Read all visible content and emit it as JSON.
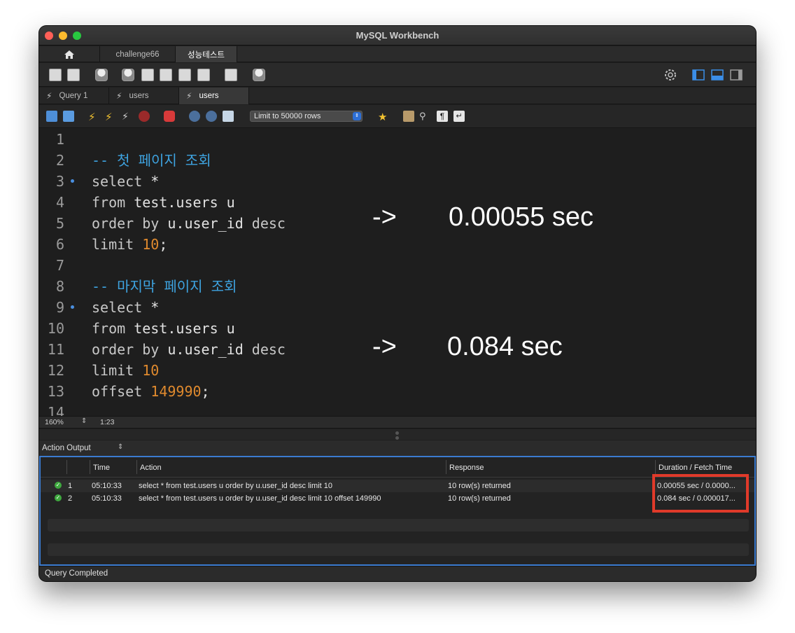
{
  "window": {
    "title": "MySQL Workbench"
  },
  "tabs": [
    {
      "label": "challenge66"
    },
    {
      "label": "성능테스트"
    }
  ],
  "query_tabs": [
    {
      "label": "Query 1"
    },
    {
      "label": "users"
    },
    {
      "label": "users"
    }
  ],
  "editor_toolbar": {
    "limit_label": "Limit to 50000 rows"
  },
  "editor": {
    "lines": [
      {
        "n": "1"
      },
      {
        "n": "2",
        "comment": "-- 첫 페이지 조회"
      },
      {
        "n": "3",
        "kw": "select",
        "rest": " *"
      },
      {
        "n": "4",
        "kw": "from",
        "rest": " test.users u"
      },
      {
        "n": "5",
        "kw": "order by",
        "rest": " u.user_id ",
        "kw2": "desc"
      },
      {
        "n": "6",
        "kw": "limit",
        "rest": " ",
        "num": "10",
        "tail": ";"
      },
      {
        "n": "7"
      },
      {
        "n": "8",
        "comment": "-- 마지막 페이지 조회"
      },
      {
        "n": "9",
        "kw": "select",
        "rest": " *"
      },
      {
        "n": "10",
        "kw": "from",
        "rest": " test.users u"
      },
      {
        "n": "11",
        "kw": "order by",
        "rest": " u.user_id ",
        "kw2": "desc"
      },
      {
        "n": "12",
        "kw": "limit",
        "rest": " ",
        "num": "10"
      },
      {
        "n": "13",
        "kw": "offset",
        "rest": " ",
        "num": "149990",
        "tail": ";"
      },
      {
        "n": "14"
      }
    ],
    "annotations": [
      {
        "arrow": "->",
        "value": "0.00055 sec"
      },
      {
        "arrow": "->",
        "value": "0.084 sec"
      }
    ]
  },
  "editor_status": {
    "zoom": "160%",
    "position": "1:23"
  },
  "output": {
    "selector_label": "Action Output",
    "columns": [
      "Time",
      "Action",
      "Response",
      "Duration / Fetch Time"
    ],
    "rows": [
      {
        "idx": "1",
        "time": "05:10:33",
        "action": "select * from test.users u order by u.user_id desc limit 10",
        "response": "10 row(s) returned",
        "duration": "0.00055 sec / 0.0000..."
      },
      {
        "idx": "2",
        "time": "05:10:33",
        "action": "select * from test.users u order by u.user_id desc limit 10 offset 149990",
        "response": "10 row(s) returned",
        "duration": "0.084 sec / 0.000017..."
      }
    ]
  },
  "status": {
    "text": "Query Completed"
  },
  "colors": {
    "accent": "#3b7bd0",
    "highlight": "#e03a2a",
    "comment": "#3ea3e0",
    "number": "#e08a2e"
  }
}
